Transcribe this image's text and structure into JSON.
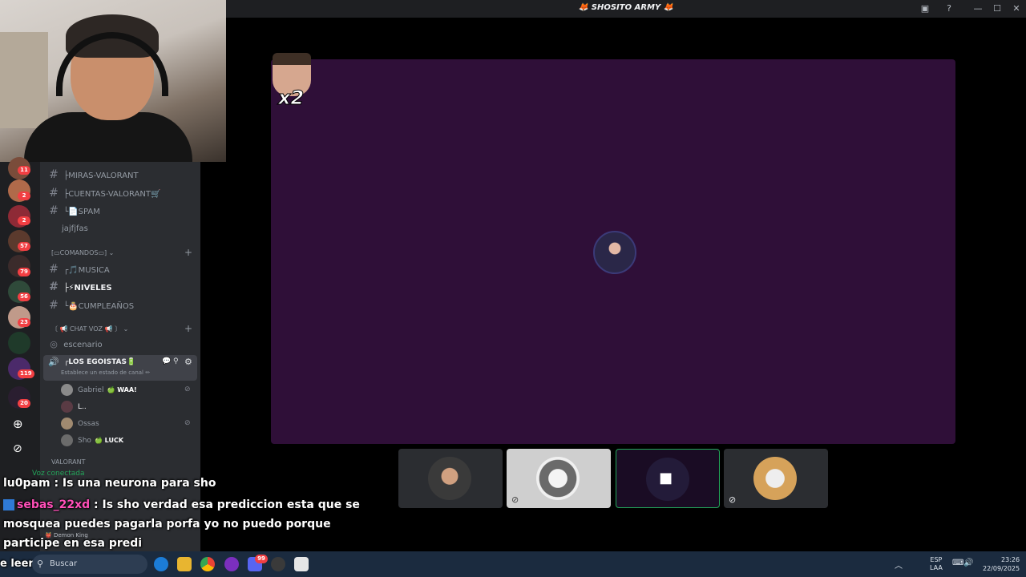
{
  "window": {
    "title": "🦊 SHOSITO ARMY 🦊"
  },
  "rail_badges": [
    "11",
    "2",
    "2",
    "57",
    "79",
    "56",
    "23",
    "119",
    "20"
  ],
  "channels": {
    "c1": "├MIRAS-VALORANT",
    "c2": "├CUENTAS-VALORANT🛒",
    "c3": "└📄SPAM",
    "c4": "jajfjfas",
    "cat1": "[▭COMANDOS▭]",
    "c5": "┌🎵MUSICA",
    "c6": "├⚡NIVELES",
    "c7": "└🎂CUMPLEAÑOS",
    "cat2": "〔 📢 CHAT VOZ 📢 〕",
    "c8": "escenario",
    "vc_name": "┌LOS EGOISTAS🔋",
    "vc_status": "Establece un estado de canal ✏",
    "cat3": "VALORANT"
  },
  "voice_users": [
    {
      "name": "Gabriel",
      "tag": "🍏 WAA!"
    },
    {
      "name": "L..",
      "tag": ""
    },
    {
      "name": "Ossas",
      "tag": ""
    },
    {
      "name": "Sho",
      "tag": "🍏 LUCK"
    }
  ],
  "voice_status": "Voz conectada",
  "user_panel_name": "👹 Demon King",
  "stage": {
    "multiplier": "x2"
  },
  "chat": {
    "u1": "lu0pam",
    "m1": ": Is una neurona para sho",
    "u2": "sebas_22xd",
    "m2": ": Is sho verdad esa prediccion esta que se",
    "m3": "mosquea puedes pagarla porfa yo no puedo porque",
    "m4": "participe en esa predi",
    "overlay_left": "e leer"
  },
  "taskbar": {
    "search": "Buscar",
    "lang_top": "ESP",
    "lang_bottom": "LAA",
    "time": "23:26",
    "date": "22/09/2025",
    "discord_badge": "99"
  },
  "colors": {
    "stage_bg": "#2f0f38",
    "accent_green": "#23a55a",
    "badge_red": "#f23f43"
  }
}
